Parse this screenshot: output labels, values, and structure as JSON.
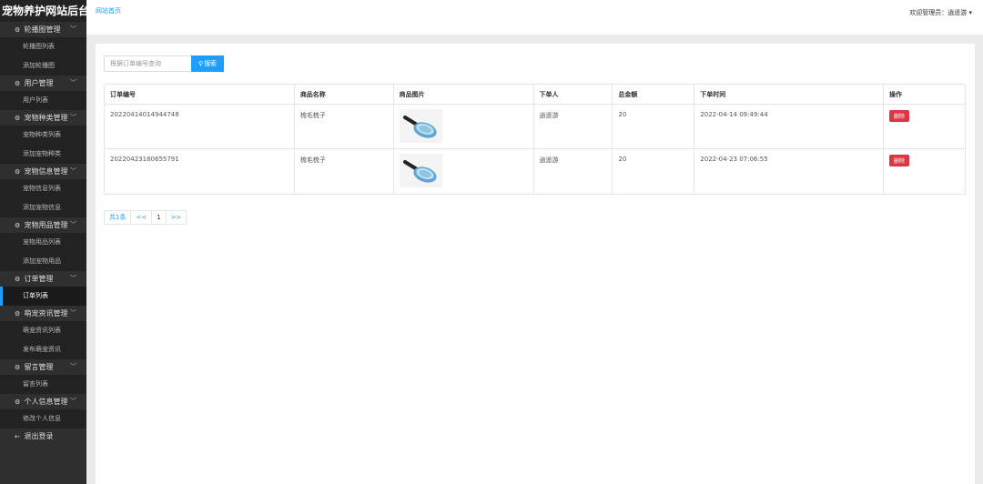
{
  "sidebar": {
    "logo": "宠物养护网站后台",
    "groups": [
      {
        "title": "轮播图管理",
        "icon": "gear-icon",
        "items": [
          "轮播图列表",
          "添加轮播图"
        ]
      },
      {
        "title": "用户管理",
        "icon": "gear-icon",
        "items": [
          "用户列表"
        ]
      },
      {
        "title": "宠物种类管理",
        "icon": "gear-icon",
        "items": [
          "宠物种类列表",
          "添加宠物种类"
        ]
      },
      {
        "title": "宠物信息管理",
        "icon": "gear-icon",
        "items": [
          "宠物信息列表",
          "添加宠物信息"
        ]
      },
      {
        "title": "宠物用品管理",
        "icon": "gear-icon",
        "items": [
          "宠物用品列表",
          "添加宠物用品"
        ]
      },
      {
        "title": "订单管理",
        "icon": "gear-icon",
        "items": [
          "订单列表"
        ]
      },
      {
        "title": "萌宠资讯管理",
        "icon": "gear-icon",
        "items": [
          "萌宠资讯列表",
          "发布萌宠资讯"
        ]
      },
      {
        "title": "留言管理",
        "icon": "gear-icon",
        "items": [
          "留言列表"
        ]
      },
      {
        "title": "个人信息管理",
        "icon": "gear-icon",
        "items": [
          "修改个人信息"
        ]
      }
    ],
    "logout": "退出登录",
    "active_item": "订单列表"
  },
  "header": {
    "home_link": "网站首页",
    "welcome": "欢迎管理员：逍遥游"
  },
  "search": {
    "placeholder": "根据订单编号查询",
    "button": "搜索"
  },
  "table": {
    "headers": [
      "订单编号",
      "商品名称",
      "商品图片",
      "下单人",
      "总金额",
      "下单时间",
      "操作"
    ],
    "rows": [
      {
        "order_no": "20220414014944748",
        "product": "梳毛梳子",
        "user": "逍遥游",
        "amount": "20",
        "time": "2022-04-14 09:49:44",
        "action": "删除"
      },
      {
        "order_no": "20220423180655791",
        "product": "梳毛梳子",
        "user": "逍遥游",
        "amount": "20",
        "time": "2022-04-23 07:06:55",
        "action": "删除"
      }
    ]
  },
  "pager": {
    "total": "共1条",
    "prev": "<<",
    "page": "1",
    "next": ">>"
  },
  "colors": {
    "sidebar_bg": "#2f2f2f",
    "accent": "#1e9fff",
    "danger": "#dc3545"
  }
}
